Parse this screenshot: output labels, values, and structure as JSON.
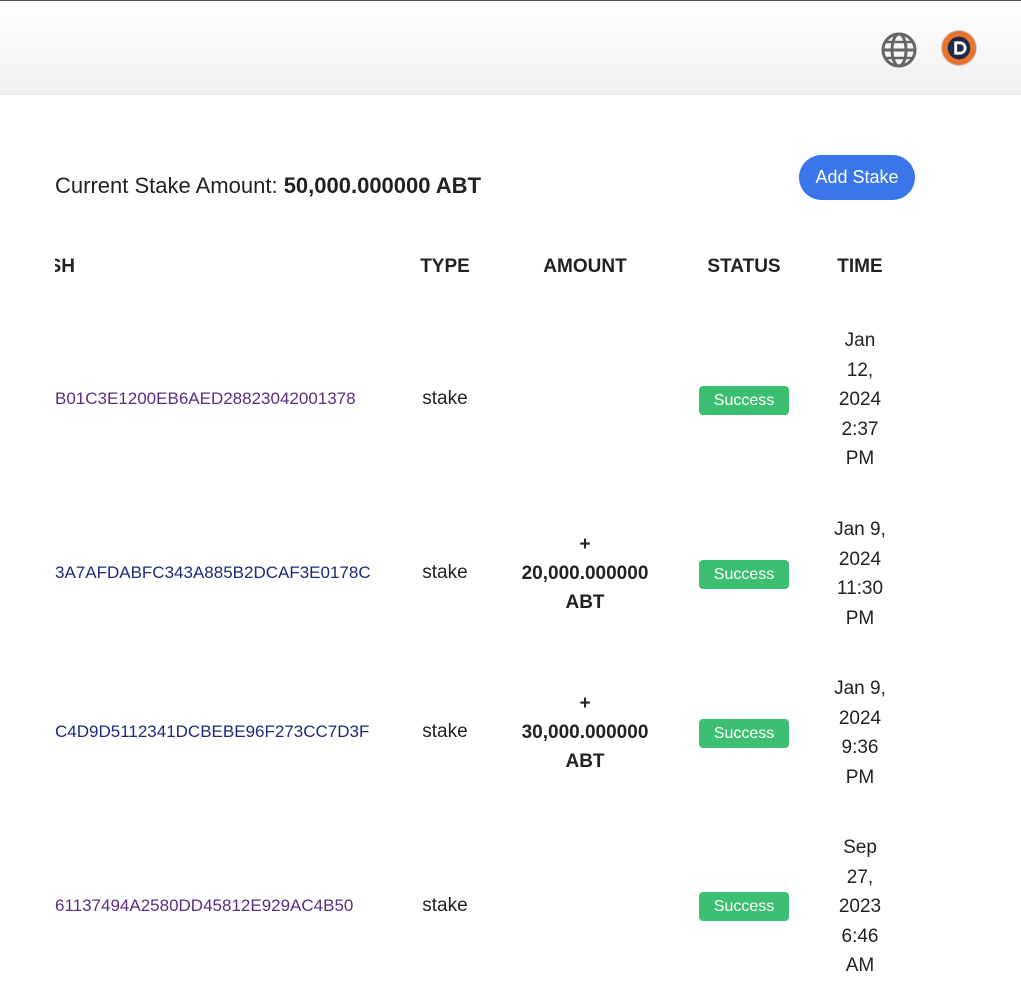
{
  "header": {
    "globe_icon": "globe-icon",
    "avatar_icon": "team-logo-avatar",
    "avatar_color": "#e8742f"
  },
  "summary": {
    "label": "Current Stake Amount:",
    "amount": "50,000.000000 ABT",
    "add_button_label": "Add Stake",
    "accent": "#3a75ea"
  },
  "table": {
    "headers": {
      "hash": "SH",
      "type": "TYPE",
      "amount": "AMOUNT",
      "status": "STATUS",
      "time": "TIME"
    },
    "status_color": "#3dbf73",
    "rows": [
      {
        "hash": "B01C3E1200EB6AED28823042001378",
        "type": "stake",
        "amount_sign": "",
        "amount_value": "",
        "amount_unit": "",
        "status": "Success",
        "time": [
          "Jan",
          "12,",
          "2024",
          "2:37",
          "PM"
        ]
      },
      {
        "hash": "3A7AFDABFC343A885B2DCAF3E0178C",
        "type": "stake",
        "amount_sign": "+",
        "amount_value": "20,000.000000",
        "amount_unit": "ABT",
        "status": "Success",
        "time": [
          "Jan 9,",
          "2024",
          "11:30",
          "PM"
        ]
      },
      {
        "hash": "C4D9D5112341DCBEBE96F273CC7D3F",
        "type": "stake",
        "amount_sign": "+",
        "amount_value": "30,000.000000",
        "amount_unit": "ABT",
        "status": "Success",
        "time": [
          "Jan 9,",
          "2024",
          "9:36",
          "PM"
        ]
      },
      {
        "hash": "61137494A2580DD45812E929AC4B50",
        "type": "stake",
        "amount_sign": "",
        "amount_value": "",
        "amount_unit": "",
        "status": "Success",
        "time": [
          "Sep",
          "27,",
          "2023",
          "6:46",
          "AM"
        ]
      }
    ]
  }
}
